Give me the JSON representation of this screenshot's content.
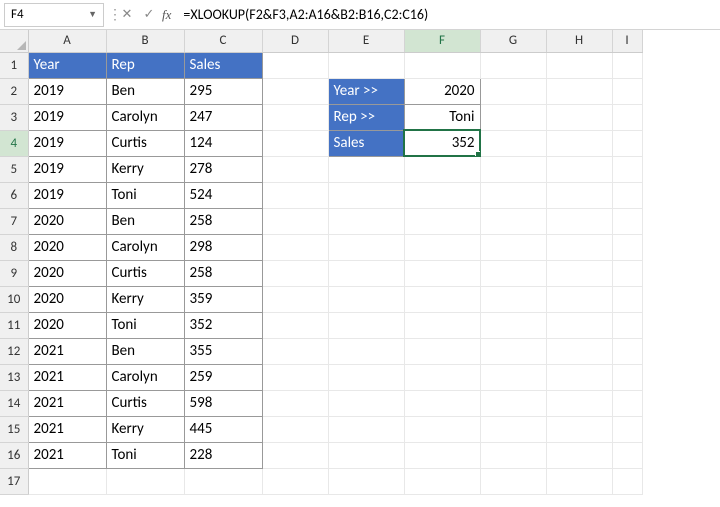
{
  "nameBox": "F4",
  "formula": "=XLOOKUP(F2&F3,A2:A16&B2:B16,C2:C16)",
  "columns": [
    "A",
    "B",
    "C",
    "D",
    "E",
    "F",
    "G",
    "H",
    "I"
  ],
  "rows": [
    "1",
    "2",
    "3",
    "4",
    "5",
    "6",
    "7",
    "8",
    "9",
    "10",
    "11",
    "12",
    "13",
    "14",
    "15",
    "16",
    "17"
  ],
  "headers": {
    "A": "Year",
    "B": "Rep",
    "C": "Sales"
  },
  "data": [
    {
      "year": "2019",
      "rep": "Ben",
      "sales": "295"
    },
    {
      "year": "2019",
      "rep": "Carolyn",
      "sales": "247"
    },
    {
      "year": "2019",
      "rep": "Curtis",
      "sales": "124"
    },
    {
      "year": "2019",
      "rep": "Kerry",
      "sales": "278"
    },
    {
      "year": "2019",
      "rep": "Toni",
      "sales": "524"
    },
    {
      "year": "2020",
      "rep": "Ben",
      "sales": "258"
    },
    {
      "year": "2020",
      "rep": "Carolyn",
      "sales": "298"
    },
    {
      "year": "2020",
      "rep": "Curtis",
      "sales": "258"
    },
    {
      "year": "2020",
      "rep": "Kerry",
      "sales": "359"
    },
    {
      "year": "2020",
      "rep": "Toni",
      "sales": "352"
    },
    {
      "year": "2021",
      "rep": "Ben",
      "sales": "355"
    },
    {
      "year": "2021",
      "rep": "Carolyn",
      "sales": "259"
    },
    {
      "year": "2021",
      "rep": "Curtis",
      "sales": "598"
    },
    {
      "year": "2021",
      "rep": "Kerry",
      "sales": "445"
    },
    {
      "year": "2021",
      "rep": "Toni",
      "sales": "228"
    }
  ],
  "lookup": {
    "yearLabel": "Year >>",
    "repLabel": "Rep >>",
    "salesLabel": "Sales",
    "yearValue": "2020",
    "repValue": "Toni",
    "salesValue": "352"
  },
  "fx": "fx"
}
